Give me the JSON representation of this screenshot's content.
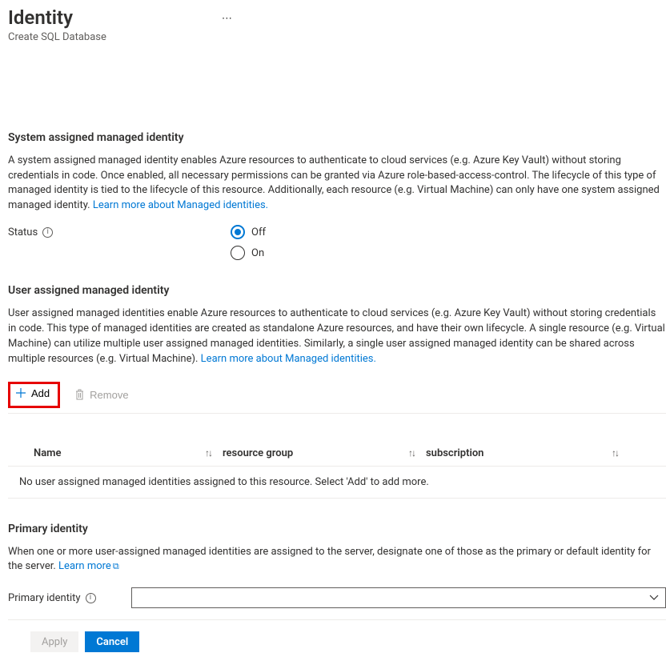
{
  "header": {
    "title": "Identity",
    "subtitle": "Create SQL Database"
  },
  "system_identity": {
    "heading": "System assigned managed identity",
    "description": "A system assigned managed identity enables Azure resources to authenticate to cloud services (e.g. Azure Key Vault) without storing credentials in code. Once enabled, all necessary permissions can be granted via Azure role-based-access-control. The lifecycle of this type of managed identity is tied to the lifecycle of this resource. Additionally, each resource (e.g. Virtual Machine) can only have one system assigned managed identity. ",
    "learn_more_label": "Learn more about Managed identities.",
    "status_label": "Status",
    "options": {
      "off": "Off",
      "on": "On"
    },
    "selected": "Off"
  },
  "user_identity": {
    "heading": "User assigned managed identity",
    "description": "User assigned managed identities enable Azure resources to authenticate to cloud services (e.g. Azure Key Vault) without storing credentials in code. This type of managed identities are created as standalone Azure resources, and have their own lifecycle. A single resource (e.g. Virtual Machine) can utilize multiple user assigned managed identities. Similarly, a single user assigned managed identity can be shared across multiple resources (e.g. Virtual Machine). ",
    "learn_more_label": "Learn more about Managed identities.",
    "toolbar": {
      "add": "Add",
      "remove": "Remove"
    },
    "columns": {
      "name": "Name",
      "resource_group": "resource group",
      "subscription": "subscription"
    },
    "empty_message": "No user assigned managed identities assigned to this resource. Select 'Add' to add more."
  },
  "primary_identity": {
    "heading": "Primary identity",
    "description": "When one or more user-assigned managed identities are assigned to the server, designate one of those as the primary or default identity for the server. ",
    "learn_more_label": "Learn more",
    "field_label": "Primary identity"
  },
  "footer": {
    "apply": "Apply",
    "cancel": "Cancel"
  }
}
